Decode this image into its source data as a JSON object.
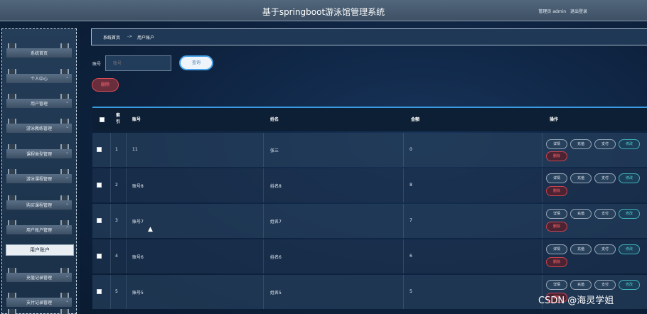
{
  "header": {
    "title": "基于springboot游泳馆管理系统",
    "user_role": "管理员 admin",
    "logout": "退出登录"
  },
  "sidebar": {
    "items": [
      {
        "label": "系统首页",
        "chevron": ""
      },
      {
        "label": "个人中心",
        "chevron": "⌄"
      },
      {
        "label": "用户管理",
        "chevron": "⌄"
      },
      {
        "label": "游泳教练管理",
        "chevron": "⌄"
      },
      {
        "label": "课程类型管理",
        "chevron": "⌄"
      },
      {
        "label": "游泳课程管理",
        "chevron": "⌄"
      },
      {
        "label": "购买课程管理",
        "chevron": "⌄"
      },
      {
        "label": "用户账户管理",
        "chevron": "⌃"
      },
      {
        "label": "充值记录管理",
        "chevron": "⌄"
      },
      {
        "label": "支付记录管理",
        "chevron": "⌄"
      }
    ],
    "submenu_active": "用户账户"
  },
  "breadcrumb": {
    "home": "系统首页",
    "separator": "->",
    "current": "用户账户"
  },
  "search": {
    "label": "账号",
    "placeholder": "账号",
    "query_button": "查询",
    "delete_button": "删除"
  },
  "table": {
    "headers": {
      "index_line1": "索",
      "index_line2": "引",
      "account": "账号",
      "name": "姓名",
      "amount": "金额",
      "actions": "操作"
    },
    "rows": [
      {
        "index": "1",
        "account": "11",
        "name": "张三",
        "amount": "0"
      },
      {
        "index": "2",
        "account": "账号8",
        "name": "姓名8",
        "amount": "8"
      },
      {
        "index": "3",
        "account": "账号7",
        "name": "姓名7",
        "amount": "7"
      },
      {
        "index": "4",
        "account": "账号6",
        "name": "姓名6",
        "amount": "6"
      },
      {
        "index": "5",
        "account": "账号5",
        "name": "姓名5",
        "amount": "5"
      }
    ],
    "actions": {
      "detail": "详情",
      "recharge": "充值",
      "pay": "支付",
      "edit": "修改",
      "delete": "删除"
    }
  },
  "watermark": "CSDN @海灵学姐",
  "colors": {
    "accent": "#3a9be2",
    "danger": "#d84b55",
    "edit": "#3fb0b8",
    "background": "#0e2340"
  }
}
